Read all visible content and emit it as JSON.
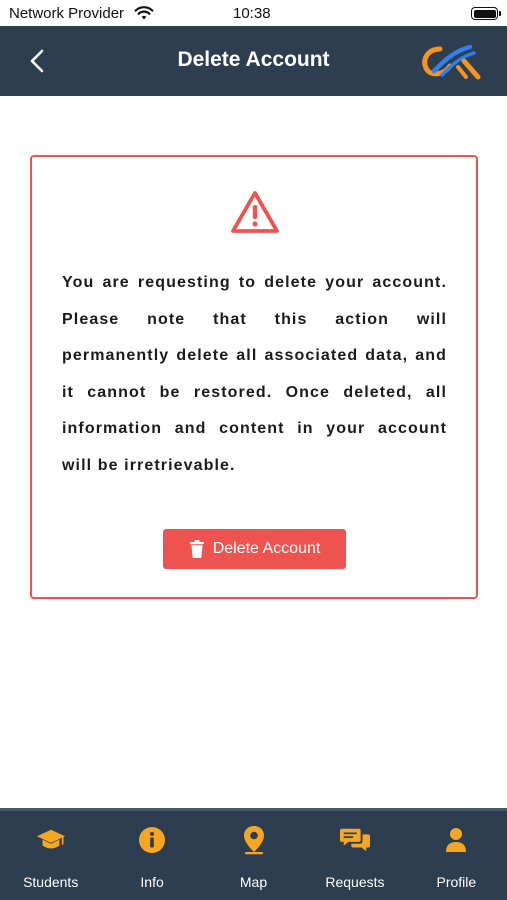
{
  "status_bar": {
    "carrier": "Network Provider",
    "time": "10:38"
  },
  "header": {
    "title": "Delete Account",
    "back_icon": "chevron-left-icon",
    "logo_icon": "app-logo-icon"
  },
  "card": {
    "warning_icon": "warning-triangle-icon",
    "message": "You are requesting to delete your account. Please note that this action will permanently delete all associated data, and it cannot be restored. Once deleted, all information and content in your account will be irretrievable.",
    "button_label": "Delete Account",
    "button_icon": "trash-icon"
  },
  "bottom_nav": {
    "items": [
      {
        "label": "Students",
        "icon": "graduation-cap-icon"
      },
      {
        "label": "Info",
        "icon": "info-icon"
      },
      {
        "label": "Map",
        "icon": "map-pin-icon"
      },
      {
        "label": "Requests",
        "icon": "chat-bubbles-icon"
      },
      {
        "label": "Profile",
        "icon": "user-icon"
      }
    ]
  },
  "colors": {
    "header_bg": "#2d3e50",
    "accent_red": "#ef5350",
    "nav_icon": "#f5a623",
    "logo_blue": "#2f80ed",
    "logo_orange": "#f7931e"
  }
}
